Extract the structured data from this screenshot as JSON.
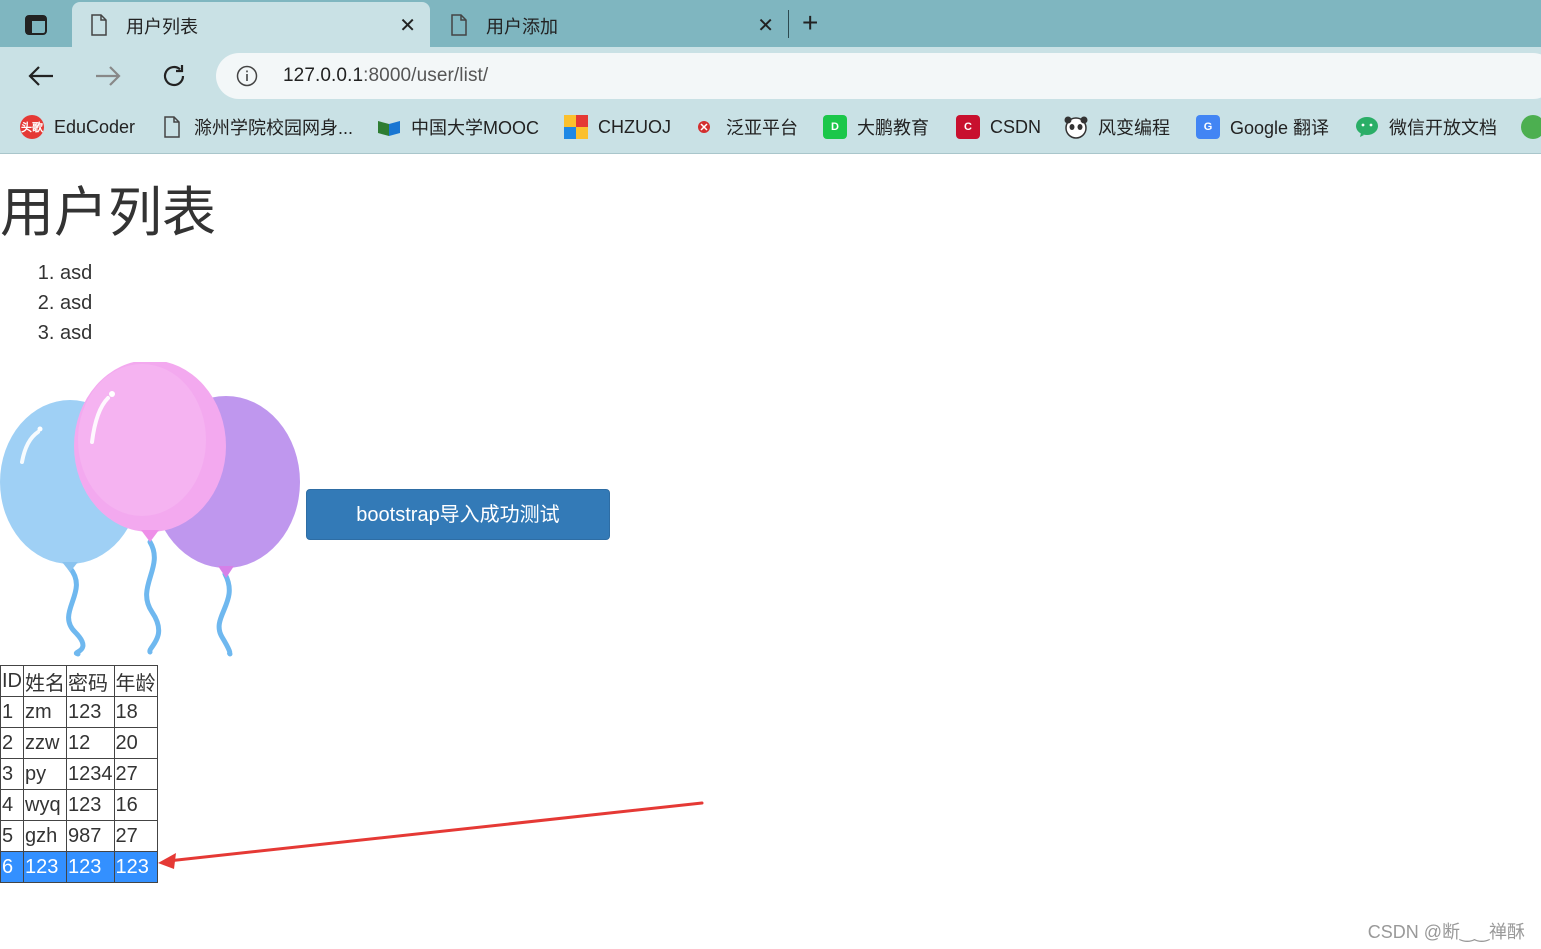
{
  "browser": {
    "tabs": [
      {
        "title": "用户列表",
        "active": true
      },
      {
        "title": "用户添加",
        "active": false
      }
    ],
    "url_host": "127.0.0.1",
    "url_path": ":8000/user/list/",
    "bookmarks": [
      {
        "label": "EduCoder",
        "icon": "educoder-icon",
        "color": "#e53935"
      },
      {
        "label": "滁州学院校园网身...",
        "icon": "page-icon",
        "color": "#ffffff"
      },
      {
        "label": "中国大学MOOC",
        "icon": "mooc-icon",
        "color": "#2e7d32"
      },
      {
        "label": "CHZUOJ",
        "icon": "chzuoj-icon",
        "color": "#fbc02d"
      },
      {
        "label": "泛亚平台",
        "icon": "fanya-icon",
        "color": "#d32f2f"
      },
      {
        "label": "大鹏教育",
        "icon": "dapeng-icon",
        "color": "#1bc74a"
      },
      {
        "label": "CSDN",
        "icon": "csdn-icon",
        "color": "#c8102e"
      },
      {
        "label": "风变编程",
        "icon": "fengbian-icon",
        "color": "#444444"
      },
      {
        "label": "Google 翻译",
        "icon": "google-translate-icon",
        "color": "#4285f4"
      },
      {
        "label": "微信开放文档",
        "icon": "wechat-icon",
        "color": "#2aae67"
      }
    ]
  },
  "page": {
    "heading": "用户列表",
    "list_items": [
      "asd",
      "asd",
      "asd"
    ],
    "button_label": "bootstrap导入成功测试",
    "table": {
      "headers": [
        "ID",
        "姓名",
        "密码",
        "年龄"
      ],
      "rows": [
        [
          "1",
          "zm",
          "123",
          "18"
        ],
        [
          "2",
          "zzw",
          "12",
          "20"
        ],
        [
          "3",
          "py",
          "1234",
          "27"
        ],
        [
          "4",
          "wyq",
          "123",
          "16"
        ],
        [
          "5",
          "gzh",
          "987",
          "27"
        ],
        [
          "6",
          "123",
          "123",
          "123"
        ]
      ],
      "selected_row_index": 5
    }
  },
  "watermark": "CSDN @断‿‿禅酥",
  "colors": {
    "tabstrip": "#7fb6c0",
    "toolbar": "#c9e1e5",
    "button": "#337ab7",
    "selection": "#3390ff",
    "arrow": "#e53935"
  }
}
